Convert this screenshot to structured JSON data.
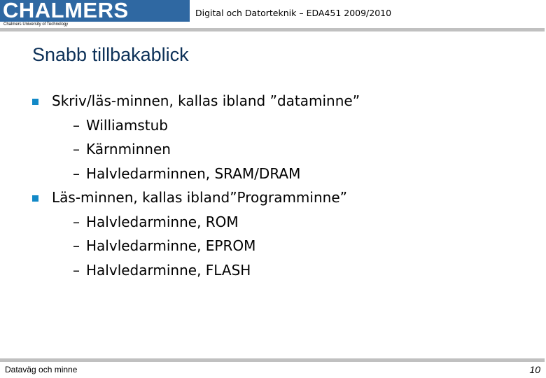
{
  "header": {
    "logo_text": "CHALMERS",
    "logo_subtitle": "Chalmers University of Technology",
    "course_title": "Digital och Datorteknik – EDA451 2009/2010",
    "logo_color": "#2f68a2"
  },
  "slide": {
    "title": "Snabb tillbakablick",
    "title_color": "#0d3158",
    "bullet_color": "#1289c7",
    "items": [
      {
        "text": "Skriv/läs-minnen, kallas ibland ”dataminne”",
        "subitems": [
          "Williamstub",
          "Kärnminnen",
          "Halvledarminnen, SRAM/DRAM"
        ]
      },
      {
        "text": "Läs-minnen, kallas ibland”Programminne”",
        "subitems": [
          "Halvledarminne, ROM",
          "Halvledarminne, EPROM",
          "Halvledarminne, FLASH"
        ]
      }
    ]
  },
  "footer": {
    "section": "Dataväg och minne",
    "page_number": "10"
  },
  "icons": {
    "bullet": "square-bullet-icon",
    "dash": "–"
  }
}
